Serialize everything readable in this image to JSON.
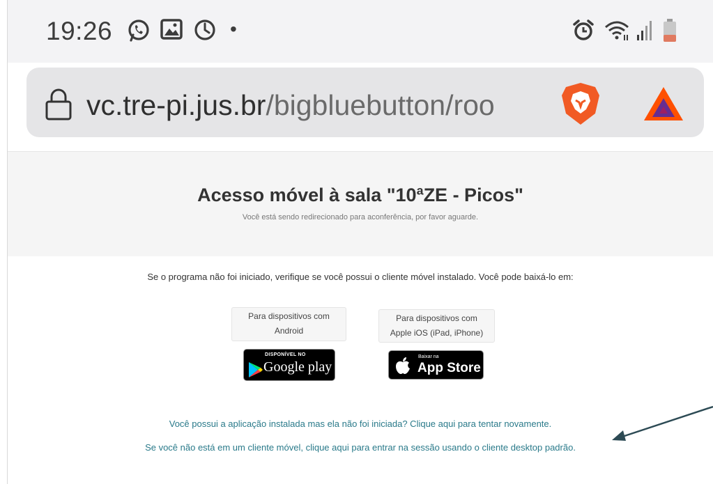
{
  "status_bar": {
    "time": "19:26",
    "dot": "•",
    "icons": [
      "whatsapp-icon",
      "gallery-icon",
      "sync-icon",
      "alarm-icon",
      "wifi-icon",
      "signal-icon",
      "battery-icon"
    ]
  },
  "browser": {
    "url_domain": "vc.tre-pi.jus.br",
    "url_path": "/bigbluebutton/roo",
    "icons": [
      "lock-icon",
      "brave-lion-icon",
      "bat-triangle-icon"
    ]
  },
  "page": {
    "title": "Acesso móvel à sala \"10ªZE - Picos\"",
    "subtitle": "Você está sendo redirecionado para aconferência, por favor aguarde.",
    "instruction": "Se o programa não foi iniciado, verifique se você possui o cliente móvel instalado. Você pode baixá-lo em:",
    "android": {
      "line1": "Para dispositivos com",
      "line2": "Android",
      "badge_top": "DISPONÍVEL NO",
      "badge_main": "Google play"
    },
    "ios": {
      "line1": "Para dispositivos com",
      "line2": "Apple iOS (iPad, iPhone)",
      "badge_top": "Baixar na",
      "badge_main": "App Store"
    },
    "link_retry": "Você possui a aplicação instalada mas ela não foi iniciada? Clique aqui para tentar novamente.",
    "link_desktop": "Se você não está em um cliente móvel, clique aqui para entrar na sessão usando o cliente desktop padrão."
  },
  "colors": {
    "link": "#2a7a8a",
    "arrow": "#2c4a54",
    "brave": "#f15a24",
    "bat_outer": "#ff5000",
    "bat_inner": "#662d91"
  }
}
